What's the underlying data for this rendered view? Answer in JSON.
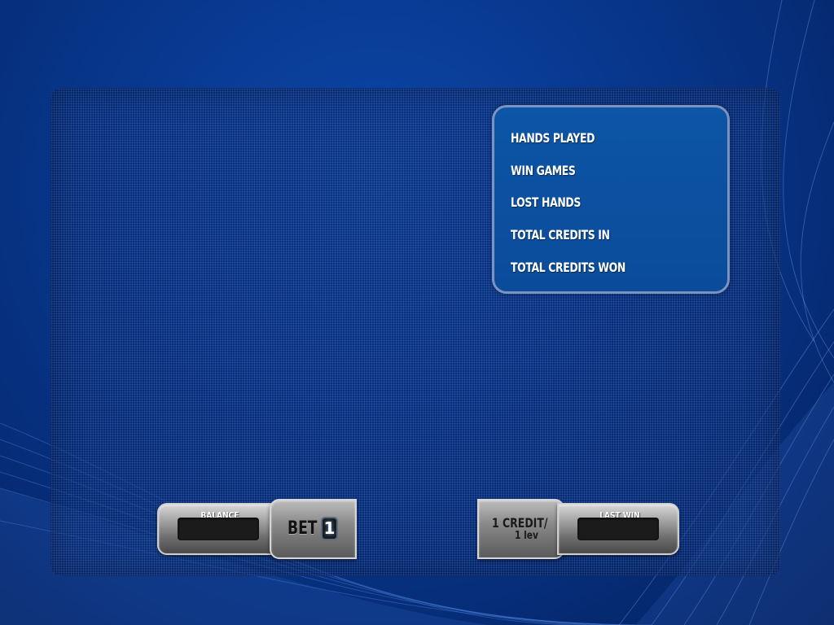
{
  "stats": {
    "hands_played_label": "HANDS PLAYED",
    "win_games_label": "WIN GAMES",
    "lost_hands_label": "LOST HANDS",
    "total_credits_in_label": "TOTAL CREDITS IN",
    "total_credits_won_label": "TOTAL CREDITS WON"
  },
  "bottom_bar": {
    "balance_label": "BALANCE",
    "balance_value": "",
    "bet_label": "BET",
    "bet_value": "1",
    "denomination_line1": "1 CREDIT/",
    "denomination_line2": "1 lev",
    "last_win_label": "LAST WIN",
    "last_win_value": ""
  },
  "colors": {
    "background": "#083a92",
    "stats_panel": "#0b4f9e",
    "stats_border": "#7a93c2",
    "metal_button": "#9a9a9a",
    "display": "#1b1b1b"
  }
}
